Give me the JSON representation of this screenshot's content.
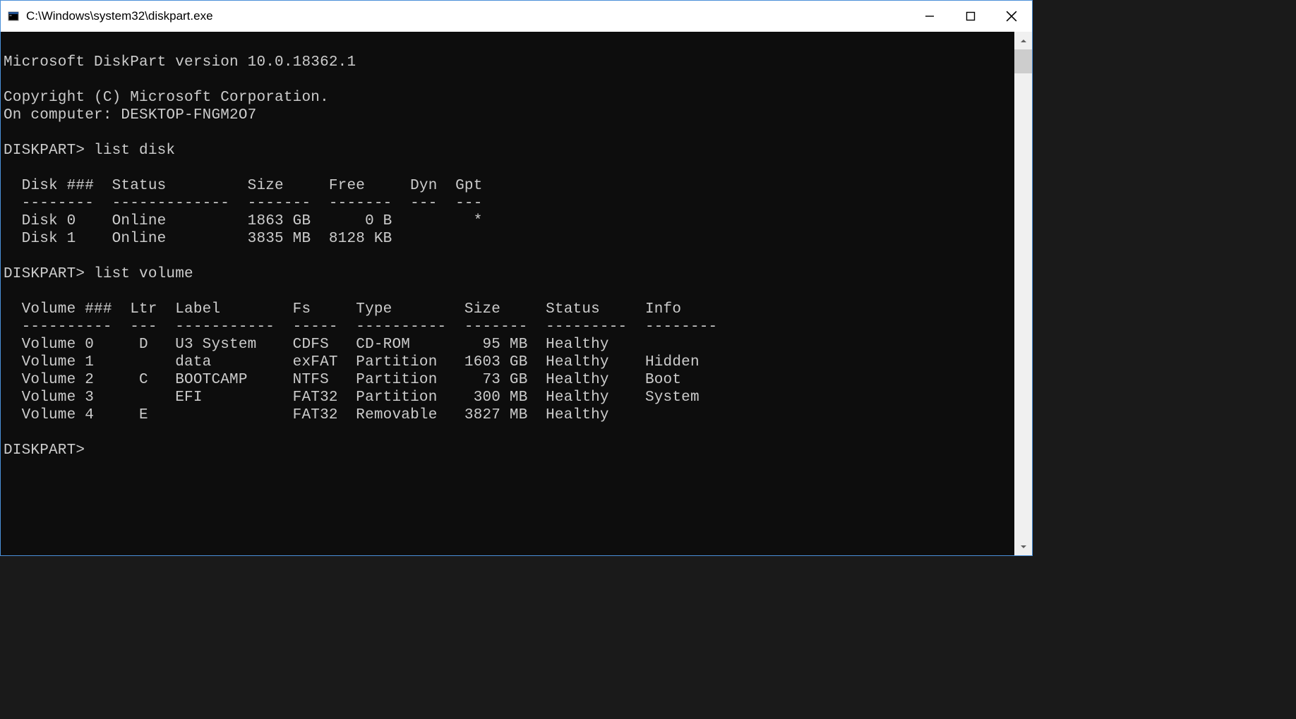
{
  "window": {
    "title": "C:\\Windows\\system32\\diskpart.exe"
  },
  "terminal": {
    "header": {
      "version_line": "Microsoft DiskPart version 10.0.18362.1",
      "copyright": "Copyright (C) Microsoft Corporation.",
      "computer_line": "On computer: DESKTOP-FNGM2O7"
    },
    "prompt": "DISKPART>",
    "commands": [
      {
        "cmd": "list disk",
        "disk_table": {
          "headers": [
            "Disk ###",
            "Status",
            "Size",
            "Free",
            "Dyn",
            "Gpt"
          ],
          "rows": [
            {
              "disk": "Disk 0",
              "status": "Online",
              "size": "1863 GB",
              "free": "0 B",
              "dyn": "",
              "gpt": "*"
            },
            {
              "disk": "Disk 1",
              "status": "Online",
              "size": "3835 MB",
              "free": "8128 KB",
              "dyn": "",
              "gpt": ""
            }
          ]
        }
      },
      {
        "cmd": "list volume",
        "vol_table": {
          "headers": [
            "Volume ###",
            "Ltr",
            "Label",
            "Fs",
            "Type",
            "Size",
            "Status",
            "Info"
          ],
          "rows": [
            {
              "volume": "Volume 0",
              "ltr": "D",
              "label": "U3 System",
              "fs": "CDFS",
              "type": "CD-ROM",
              "size": "95 MB",
              "status": "Healthy",
              "info": ""
            },
            {
              "volume": "Volume 1",
              "ltr": "",
              "label": "data",
              "fs": "exFAT",
              "type": "Partition",
              "size": "1603 GB",
              "status": "Healthy",
              "info": "Hidden"
            },
            {
              "volume": "Volume 2",
              "ltr": "C",
              "label": "BOOTCAMP",
              "fs": "NTFS",
              "type": "Partition",
              "size": "73 GB",
              "status": "Healthy",
              "info": "Boot"
            },
            {
              "volume": "Volume 3",
              "ltr": "",
              "label": "EFI",
              "fs": "FAT32",
              "type": "Partition",
              "size": "300 MB",
              "status": "Healthy",
              "info": "System"
            },
            {
              "volume": "Volume 4",
              "ltr": "E",
              "label": "",
              "fs": "FAT32",
              "type": "Removable",
              "size": "3827 MB",
              "status": "Healthy",
              "info": ""
            }
          ]
        }
      }
    ]
  }
}
